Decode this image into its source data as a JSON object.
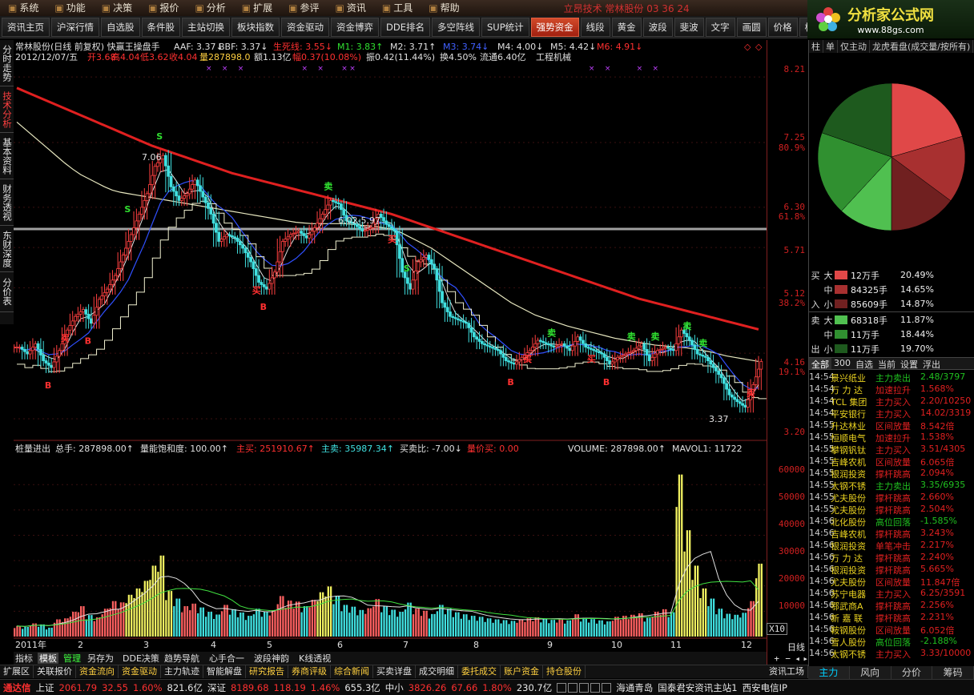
{
  "menu": {
    "items": [
      "系统",
      "功能",
      "决策",
      "报价",
      "分析",
      "扩展",
      "参评",
      "资讯",
      "工具",
      "帮助"
    ],
    "ticker": "立昂技术 常林股份 03 36 24"
  },
  "toolbar": {
    "buttons": [
      "资讯主页",
      "沪深行情",
      "自选股",
      "条件股",
      "主站切换",
      "板块指数",
      "资金驱动",
      "资金博弈",
      "DDE排名",
      "多空阵线",
      "SUP统计",
      "强势资金",
      "线段",
      "黄金",
      "波段",
      "斐波",
      "文字",
      "画圆",
      "价格",
      "标价",
      "眼"
    ],
    "highlight": "强势资金"
  },
  "logo": {
    "name": "分析家公式网",
    "url": "www.88gs.com"
  },
  "side_tabs": [
    "分时走势",
    "技术分析",
    "基本资料",
    "财务透视",
    "东财深度",
    "分价表"
  ],
  "price_header": {
    "line1_title": "常林股份(日线 前复权) 快赢王操盘手",
    "aaf": "AAF: 3.37↓",
    "bbf": "BBF: 3.37↓",
    "sxx": "生死线: 3.55↓",
    "m1": "M1: 3.83↑",
    "m2": "M2: 3.71↑",
    "m3": "M3: 3.74↓",
    "m4": "M4: 4.00↓",
    "m5": "M5: 4.42↓",
    "m6": "M6: 4.91↓",
    "line2_date": "2012/12/07/五",
    "open": "开3.68",
    "high": "高4.04",
    "low": "低3.62",
    "close": "收4.04",
    "vol": "量287898.0",
    "amt": "额1.13亿",
    "chg": "幅0.37(10.08%)",
    "amp": "振0.42(11.44%)",
    "turn": "换4.50%",
    "float": "流通6.40亿",
    "industry": "工程机械"
  },
  "chart_annotations": {
    "hi_label": "7.06",
    "lo_label": "3.37",
    "cursor_label": "6.02-5.97",
    "buy": "买",
    "sell": "卖",
    "b": "B",
    "s": "S"
  },
  "price_axis": {
    "ticks": [
      "8.21",
      "7.25",
      "6.30",
      "5.71",
      "5.12",
      "4.16",
      "3.20"
    ],
    "pcts": [
      "80.9%",
      "61.8%",
      "38.2%",
      "19.1%"
    ]
  },
  "volume_header": {
    "title": "桩量进出",
    "total": "总手: 287898.00↑",
    "sat": "量能饱和度: 100.00↑",
    "zmr": "主买: 251910.67↑",
    "zmc": "主卖: 35987.34↑",
    "ratio": "买卖比: -7.00↓",
    "ljm": "量价买: 0.00",
    "volume": "VOLUME: 287898.00↑",
    "mavol": "MAVOL1: 11722"
  },
  "volume_axis": {
    "ticks": [
      "60000",
      "50000",
      "40000",
      "30000",
      "20000",
      "10000"
    ],
    "unit": "X10"
  },
  "time_axis": {
    "labels": [
      "2011年",
      "2",
      "3",
      "4",
      "5",
      "6",
      "7",
      "8",
      "9",
      "10",
      "11",
      "12"
    ],
    "period": "日线"
  },
  "indicator_tabs": [
    "指标",
    "模板",
    "管理",
    "另存为",
    "DDE决策",
    "趋势导航",
    "心手合一",
    "波段神韵",
    "K线透视"
  ],
  "right_panel": {
    "tabs": [
      "柱",
      "单",
      "仅主动",
      "龙虎看盘(成交量/按所有)"
    ],
    "pie": [
      {
        "label": "大买",
        "pct": 20.49,
        "color": "#e04848"
      },
      {
        "label": "中买",
        "pct": 14.65,
        "color": "#a83030"
      },
      {
        "label": "小买",
        "pct": 14.87,
        "color": "#702020"
      },
      {
        "label": "大卖",
        "pct": 11.87,
        "color": "#50c050"
      },
      {
        "label": "中卖",
        "pct": 18.44,
        "color": "#309030"
      },
      {
        "label": "小卖",
        "pct": 19.7,
        "color": "#1e5a1e"
      }
    ],
    "flows": [
      {
        "side": "买",
        "level": "大",
        "amount": "12万手",
        "pct": "20.49%",
        "color": "#e04848"
      },
      {
        "side": "",
        "level": "中",
        "amount": "84325手",
        "pct": "14.65%",
        "color": "#a83030"
      },
      {
        "side": "入",
        "level": "小",
        "amount": "85609手",
        "pct": "14.87%",
        "color": "#702020"
      },
      {
        "side": "卖",
        "level": "大",
        "amount": "68318手",
        "pct": "11.87%",
        "color": "#50c050"
      },
      {
        "side": "",
        "level": "中",
        "amount": "11万手",
        "pct": "18.44%",
        "color": "#309030"
      },
      {
        "side": "出",
        "level": "小",
        "amount": "11万手",
        "pct": "19.70%",
        "color": "#1e5a1e"
      }
    ],
    "filter_tabs": [
      "全部",
      "300",
      "自选",
      "当前",
      "设置",
      "浮出"
    ],
    "news": [
      {
        "t": "14:54",
        "n": "景兴纸业",
        "e": "主力卖出",
        "v": "2.48/3797",
        "sell": true
      },
      {
        "t": "14:54",
        "n": "万 力 达",
        "e": "加速拉升",
        "v": "1.568%",
        "sell": false
      },
      {
        "t": "14:54",
        "n": "TCL 集团",
        "e": "主力买入",
        "v": "2.20/10250",
        "sell": false
      },
      {
        "t": "14:54",
        "n": "平安银行",
        "e": "主力买入",
        "v": "14.02/3319",
        "sell": false
      },
      {
        "t": "14:55",
        "n": "升达林业",
        "e": "区间放量",
        "v": "8.542倍",
        "sell": false
      },
      {
        "t": "14:55",
        "n": "恒顺电气",
        "e": "加速拉升",
        "v": "1.538%",
        "sell": false
      },
      {
        "t": "14:55",
        "n": "攀钢钒钛",
        "e": "主力买入",
        "v": "3.51/4305",
        "sell": false
      },
      {
        "t": "14:55",
        "n": "吉峰农机",
        "e": "区间放量",
        "v": "6.065倍",
        "sell": false
      },
      {
        "t": "14:55",
        "n": "银润投资",
        "e": "撑杆跳高",
        "v": "2.094%",
        "sell": false
      },
      {
        "t": "14:55",
        "n": "太钢不锈",
        "e": "主力卖出",
        "v": "3.35/6935",
        "sell": true
      },
      {
        "t": "14:55",
        "n": "尤夫股份",
        "e": "撑杆跳高",
        "v": "2.660%",
        "sell": false
      },
      {
        "t": "14:55",
        "n": "尤夫股份",
        "e": "撑杆跳高",
        "v": "2.504%",
        "sell": false
      },
      {
        "t": "14:56",
        "n": "北化股份",
        "e": "高位回落",
        "v": "-1.585%",
        "sell": true
      },
      {
        "t": "14:56",
        "n": "吉峰农机",
        "e": "撑杆跳高",
        "v": "3.243%",
        "sell": false
      },
      {
        "t": "14:56",
        "n": "银润投资",
        "e": "单笔冲击",
        "v": "2.217%",
        "sell": false
      },
      {
        "t": "14:56",
        "n": "万 力 达",
        "e": "撑杆跳高",
        "v": "2.240%",
        "sell": false
      },
      {
        "t": "14:56",
        "n": "银润投资",
        "e": "撑杆跳高",
        "v": "5.665%",
        "sell": false
      },
      {
        "t": "14:56",
        "n": "尤夫股份",
        "e": "区间放量",
        "v": "11.847倍",
        "sell": false
      },
      {
        "t": "14:56",
        "n": "苏宁电器",
        "e": "主力买入",
        "v": "6.25/3591",
        "sell": false
      },
      {
        "t": "14:56",
        "n": "鄂武商A",
        "e": "撑杆跳高",
        "v": "2.256%",
        "sell": false
      },
      {
        "t": "14:56",
        "n": "新 嘉 联",
        "e": "撑杆跳高",
        "v": "2.231%",
        "sell": false
      },
      {
        "t": "14:56",
        "n": "鞍钢股份",
        "e": "区间放量",
        "v": "6.052倍",
        "sell": false
      },
      {
        "t": "14:56",
        "n": "雪人股份",
        "e": "高位回落",
        "v": "-2.188%",
        "sell": true
      },
      {
        "t": "14:56",
        "n": "太钢不锈",
        "e": "主力买入",
        "v": "3.33/10000",
        "sell": false
      }
    ],
    "bottom_tabs": [
      "主力",
      "风向",
      "分价",
      "筹码"
    ]
  },
  "bottom_tabs": [
    "扩展区",
    "关联报价",
    "资金流向",
    "资金驱动",
    "主力轨迹",
    "智能解盘",
    "研究报告",
    "券商评级",
    "综合新闻",
    "买卖详盘",
    "成交明细",
    "委托成交",
    "账户资金",
    "持仓股份",
    "资讯工场"
  ],
  "status": {
    "brand": "通达信",
    "sh_label": "上证",
    "sh_val": "2061.79",
    "sh_chg": "32.55",
    "sh_pct": "1.60%",
    "sh_amt": "821.6亿",
    "sz_label": "深证",
    "sz_val": "8189.68",
    "sz_chg": "118.19",
    "sz_pct": "1.46%",
    "sz_amt": "655.3亿",
    "zx_label": "中小",
    "zx_val": "3826.26",
    "zx_chg": "67.66",
    "zx_pct": "1.80%",
    "zx_amt": "230.7亿",
    "site": "海通青岛",
    "server": "国泰君安资讯主站1",
    "net": "西安电信IP"
  },
  "chart_data": [
    {
      "type": "candlestick",
      "title": "常林股份(日线 前复权)",
      "ylim": [
        3.0,
        8.4
      ],
      "x_labels": [
        "2011年",
        "2",
        "3",
        "4",
        "5",
        "6",
        "7",
        "8",
        "9",
        "10",
        "11",
        "12"
      ],
      "close_series": [
        4.25,
        4.15,
        4.3,
        4.05,
        3.95,
        4.2,
        4.5,
        4.7,
        4.8,
        4.6,
        4.95,
        5.1,
        5.3,
        5.6,
        5.9,
        6.2,
        6.5,
        6.9,
        7.06,
        6.6,
        6.4,
        6.5,
        6.7,
        6.45,
        6.2,
        5.8,
        5.9,
        5.85,
        5.7,
        5.5,
        5.2,
        5.1,
        5.35,
        5.8,
        5.9,
        5.95,
        5.85,
        6.0,
        6.2,
        6.4,
        6.35,
        6.1,
        6.05,
        5.95,
        6.0,
        6.2,
        6.05,
        5.95,
        5.35,
        5.1,
        5.5,
        5.6,
        5.4,
        4.9,
        4.7,
        4.65,
        4.6,
        4.4,
        4.3,
        4.25,
        4.2,
        4.05,
        4.0,
        4.1,
        4.2,
        4.35,
        4.3,
        4.25,
        4.3,
        4.2,
        4.4,
        4.25,
        4.2,
        4.15,
        4.0,
        4.1,
        4.15,
        4.2,
        4.3,
        4.05,
        4.2,
        4.25,
        4.2,
        4.5,
        4.35,
        4.15,
        4.1,
        3.95,
        3.8,
        3.55,
        3.45,
        3.37,
        3.7,
        4.04
      ],
      "series": [
        {
          "name": "M6",
          "values": [
            8.05,
            8.0,
            7.95,
            7.9,
            7.85,
            7.8,
            7.75,
            7.7,
            7.65,
            7.6,
            7.55,
            7.5,
            7.45,
            7.4,
            7.35,
            7.3,
            7.25,
            7.2,
            7.16,
            7.12,
            7.08,
            7.04,
            7.0,
            6.96,
            6.92,
            6.88,
            6.84,
            6.8,
            6.77,
            6.74,
            6.71,
            6.68,
            6.65,
            6.62,
            6.59,
            6.56,
            6.53,
            6.5,
            6.47,
            6.44,
            6.41,
            6.38,
            6.35,
            6.32,
            6.29,
            6.26,
            6.23,
            6.2,
            6.16,
            6.12,
            6.08,
            6.04,
            6.0,
            5.96,
            5.92,
            5.88,
            5.84,
            5.8,
            5.76,
            5.72,
            5.68,
            5.64,
            5.6,
            5.56,
            5.52,
            5.48,
            5.44,
            5.4,
            5.36,
            5.32,
            5.28,
            5.24,
            5.2,
            5.16,
            5.12,
            5.08,
            5.04,
            5.0,
            4.96,
            4.93,
            4.9,
            4.87,
            4.84,
            4.81,
            4.78,
            4.75,
            4.72,
            4.69,
            4.66,
            4.63,
            4.6,
            4.57,
            4.54,
            4.51
          ]
        },
        {
          "name": "M5",
          "values": [
            7.55,
            7.45,
            7.35,
            7.25,
            7.15,
            7.05,
            6.95,
            6.86,
            6.78,
            6.72,
            6.66,
            6.6,
            6.55,
            6.52,
            6.5,
            6.48,
            6.46,
            6.44,
            6.42,
            6.4,
            6.38,
            6.36,
            6.34,
            6.32,
            6.3,
            6.28,
            6.26,
            6.24,
            6.22,
            6.2,
            6.18,
            6.16,
            6.14,
            6.12,
            6.1,
            6.08,
            6.07,
            6.06,
            6.06,
            6.06,
            6.06,
            6.06,
            6.05,
            6.04,
            6.03,
            6.02,
            6.0,
            5.98,
            5.94,
            5.88,
            5.82,
            5.76,
            5.7,
            5.62,
            5.54,
            5.46,
            5.38,
            5.3,
            5.22,
            5.14,
            5.06,
            4.98,
            4.9,
            4.84,
            4.78,
            4.72,
            4.68,
            4.64,
            4.6,
            4.56,
            4.53,
            4.5,
            4.47,
            4.44,
            4.41,
            4.38,
            4.36,
            4.34,
            4.32,
            4.3,
            4.28,
            4.27,
            4.26,
            4.25,
            4.24,
            4.22,
            4.2,
            4.18,
            4.15,
            4.12,
            4.1,
            4.08,
            4.06,
            4.04
          ]
        }
      ]
    },
    {
      "type": "bar",
      "title": "桩量进出",
      "ylim": [
        0,
        68000
      ],
      "values": [
        4200,
        3800,
        5200,
        4800,
        3500,
        6800,
        7200,
        9800,
        12000,
        8500,
        7600,
        11000,
        14000,
        13500,
        16500,
        19000,
        22000,
        28000,
        32000,
        18000,
        15000,
        12000,
        13000,
        11500,
        9800,
        8700,
        12500,
        10800,
        9500,
        8200,
        11000,
        9800,
        10400,
        16000,
        14200,
        13800,
        12000,
        14500,
        17500,
        19800,
        16000,
        12500,
        11800,
        10500,
        11200,
        14800,
        12000,
        10600,
        9800,
        13400,
        11000,
        10200,
        8900,
        12500,
        11000,
        9600,
        8800,
        8200,
        7800,
        7200,
        6800,
        6500,
        6200,
        6800,
        7200,
        7600,
        7000,
        6600,
        6900,
        6400,
        8800,
        7400,
        6900,
        6400,
        6000,
        7800,
        8200,
        8600,
        9200,
        7400,
        9800,
        10800,
        9600,
        64000,
        42000,
        28000,
        19000,
        15000,
        11000,
        9000,
        8600,
        9400,
        14000,
        28789
      ]
    }
  ]
}
